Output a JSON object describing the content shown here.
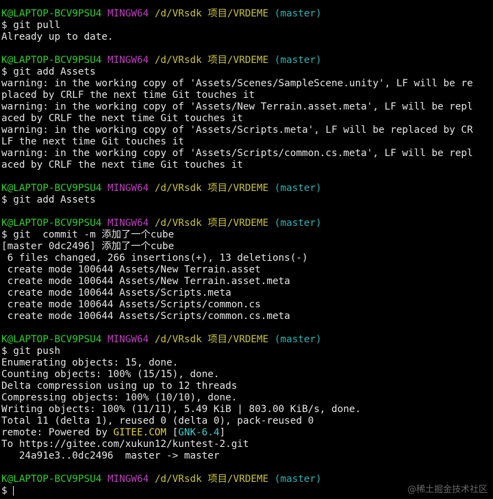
{
  "colors": {
    "background": "#000000",
    "text": "#e6e6e6",
    "user": "#2fd12f",
    "host": "#bf3fbf",
    "path": "#c9c33a",
    "branch": "#2fb3b3",
    "gitee": "#e2d23a"
  },
  "terminal": {
    "lines": [
      {
        "kind": "prompt",
        "segs": [
          {
            "c": "user",
            "t": "K@LAPTOP-BCV9PSU4"
          },
          {
            "c": "text",
            "t": " "
          },
          {
            "c": "host",
            "t": "MINGW64"
          },
          {
            "c": "text",
            "t": " "
          },
          {
            "c": "path",
            "t": "/d/VRsdk 项目/VRDEME"
          },
          {
            "c": "text",
            "t": " "
          },
          {
            "c": "branch",
            "t": "(master)"
          }
        ]
      },
      {
        "kind": "command",
        "segs": [
          {
            "c": "text",
            "t": "$ git pull"
          }
        ]
      },
      {
        "kind": "output",
        "segs": [
          {
            "c": "text",
            "t": "Already up to date."
          }
        ]
      },
      {
        "kind": "blank",
        "segs": []
      },
      {
        "kind": "prompt",
        "segs": [
          {
            "c": "user",
            "t": "K@LAPTOP-BCV9PSU4"
          },
          {
            "c": "text",
            "t": " "
          },
          {
            "c": "host",
            "t": "MINGW64"
          },
          {
            "c": "text",
            "t": " "
          },
          {
            "c": "path",
            "t": "/d/VRsdk 项目/VRDEME"
          },
          {
            "c": "text",
            "t": " "
          },
          {
            "c": "branch",
            "t": "(master)"
          }
        ]
      },
      {
        "kind": "command",
        "segs": [
          {
            "c": "text",
            "t": "$ git add Assets"
          }
        ]
      },
      {
        "kind": "output",
        "segs": [
          {
            "c": "text",
            "t": "warning: in the working copy of 'Assets/Scenes/SampleScene.unity', LF will be re"
          }
        ]
      },
      {
        "kind": "output",
        "segs": [
          {
            "c": "text",
            "t": "placed by CRLF the next time Git touches it"
          }
        ]
      },
      {
        "kind": "output",
        "segs": [
          {
            "c": "text",
            "t": "warning: in the working copy of 'Assets/New Terrain.asset.meta', LF will be repl"
          }
        ]
      },
      {
        "kind": "output",
        "segs": [
          {
            "c": "text",
            "t": "aced by CRLF the next time Git touches it"
          }
        ]
      },
      {
        "kind": "output",
        "segs": [
          {
            "c": "text",
            "t": "warning: in the working copy of 'Assets/Scripts.meta', LF will be replaced by CR"
          }
        ]
      },
      {
        "kind": "output",
        "segs": [
          {
            "c": "text",
            "t": "LF the next time Git touches it"
          }
        ]
      },
      {
        "kind": "output",
        "segs": [
          {
            "c": "text",
            "t": "warning: in the working copy of 'Assets/Scripts/common.cs.meta', LF will be repl"
          }
        ]
      },
      {
        "kind": "output",
        "segs": [
          {
            "c": "text",
            "t": "aced by CRLF the next time Git touches it"
          }
        ]
      },
      {
        "kind": "blank",
        "segs": []
      },
      {
        "kind": "prompt",
        "segs": [
          {
            "c": "user",
            "t": "K@LAPTOP-BCV9PSU4"
          },
          {
            "c": "text",
            "t": " "
          },
          {
            "c": "host",
            "t": "MINGW64"
          },
          {
            "c": "text",
            "t": " "
          },
          {
            "c": "path",
            "t": "/d/VRsdk 项目/VRDEME"
          },
          {
            "c": "text",
            "t": " "
          },
          {
            "c": "branch",
            "t": "(master)"
          }
        ]
      },
      {
        "kind": "command",
        "segs": [
          {
            "c": "text",
            "t": "$ git add Assets"
          }
        ]
      },
      {
        "kind": "blank",
        "segs": []
      },
      {
        "kind": "prompt",
        "segs": [
          {
            "c": "user",
            "t": "K@LAPTOP-BCV9PSU4"
          },
          {
            "c": "text",
            "t": " "
          },
          {
            "c": "host",
            "t": "MINGW64"
          },
          {
            "c": "text",
            "t": " "
          },
          {
            "c": "path",
            "t": "/d/VRsdk 项目/VRDEME"
          },
          {
            "c": "text",
            "t": " "
          },
          {
            "c": "branch",
            "t": "(master)"
          }
        ]
      },
      {
        "kind": "command",
        "segs": [
          {
            "c": "text",
            "t": "$ git  commit -m 添加了一个cube"
          }
        ]
      },
      {
        "kind": "output",
        "segs": [
          {
            "c": "text",
            "t": "[master 0dc2496] 添加了一个cube"
          }
        ]
      },
      {
        "kind": "output",
        "segs": [
          {
            "c": "text",
            "t": " 6 files changed, 266 insertions(+), 13 deletions(-)"
          }
        ]
      },
      {
        "kind": "output",
        "segs": [
          {
            "c": "text",
            "t": " create mode 100644 Assets/New Terrain.asset"
          }
        ]
      },
      {
        "kind": "output",
        "segs": [
          {
            "c": "text",
            "t": " create mode 100644 Assets/New Terrain.asset.meta"
          }
        ]
      },
      {
        "kind": "output",
        "segs": [
          {
            "c": "text",
            "t": " create mode 100644 Assets/Scripts.meta"
          }
        ]
      },
      {
        "kind": "output",
        "segs": [
          {
            "c": "text",
            "t": " create mode 100644 Assets/Scripts/common.cs"
          }
        ]
      },
      {
        "kind": "output",
        "segs": [
          {
            "c": "text",
            "t": " create mode 100644 Assets/Scripts/common.cs.meta"
          }
        ]
      },
      {
        "kind": "blank",
        "segs": []
      },
      {
        "kind": "prompt",
        "segs": [
          {
            "c": "user",
            "t": "K@LAPTOP-BCV9PSU4"
          },
          {
            "c": "text",
            "t": " "
          },
          {
            "c": "host",
            "t": "MINGW64"
          },
          {
            "c": "text",
            "t": " "
          },
          {
            "c": "path",
            "t": "/d/VRsdk 项目/VRDEME"
          },
          {
            "c": "text",
            "t": " "
          },
          {
            "c": "branch",
            "t": "(master)"
          }
        ]
      },
      {
        "kind": "command",
        "segs": [
          {
            "c": "text",
            "t": "$ git push"
          }
        ]
      },
      {
        "kind": "output",
        "segs": [
          {
            "c": "text",
            "t": "Enumerating objects: 15, done."
          }
        ]
      },
      {
        "kind": "output",
        "segs": [
          {
            "c": "text",
            "t": "Counting objects: 100% (15/15), done."
          }
        ]
      },
      {
        "kind": "output",
        "segs": [
          {
            "c": "text",
            "t": "Delta compression using up to 12 threads"
          }
        ]
      },
      {
        "kind": "output",
        "segs": [
          {
            "c": "text",
            "t": "Compressing objects: 100% (10/10), done."
          }
        ]
      },
      {
        "kind": "output",
        "segs": [
          {
            "c": "text",
            "t": "Writing objects: 100% (11/11), 5.49 KiB | 803.00 KiB/s, done."
          }
        ]
      },
      {
        "kind": "output",
        "segs": [
          {
            "c": "text",
            "t": "Total 11 (delta 1), reused 0 (delta 0), pack-reused 0"
          }
        ]
      },
      {
        "kind": "output",
        "segs": [
          {
            "c": "text",
            "t": "remote: Powered by "
          },
          {
            "c": "gitee",
            "t": "GITEE.COM"
          },
          {
            "c": "text",
            "t": " ["
          },
          {
            "c": "tag",
            "t": "GNK-6.4"
          },
          {
            "c": "text",
            "t": "]"
          }
        ]
      },
      {
        "kind": "output",
        "segs": [
          {
            "c": "text",
            "t": "To https://gitee.com/xukun12/kuntest-2.git"
          }
        ]
      },
      {
        "kind": "output",
        "segs": [
          {
            "c": "text",
            "t": "   24a91e3..0dc2496  master -> master"
          }
        ]
      },
      {
        "kind": "blank",
        "segs": []
      },
      {
        "kind": "prompt",
        "segs": [
          {
            "c": "user",
            "t": "K@LAPTOP-BCV9PSU4"
          },
          {
            "c": "text",
            "t": " "
          },
          {
            "c": "host",
            "t": "MINGW64"
          },
          {
            "c": "text",
            "t": " "
          },
          {
            "c": "path",
            "t": "/d/VRsdk 项目/VRDEME"
          },
          {
            "c": "text",
            "t": " "
          },
          {
            "c": "branch",
            "t": "(master)"
          }
        ]
      },
      {
        "kind": "input",
        "segs": [
          {
            "c": "text",
            "t": "$ "
          }
        ]
      }
    ]
  },
  "watermark": "@稀土掘金技术社区"
}
